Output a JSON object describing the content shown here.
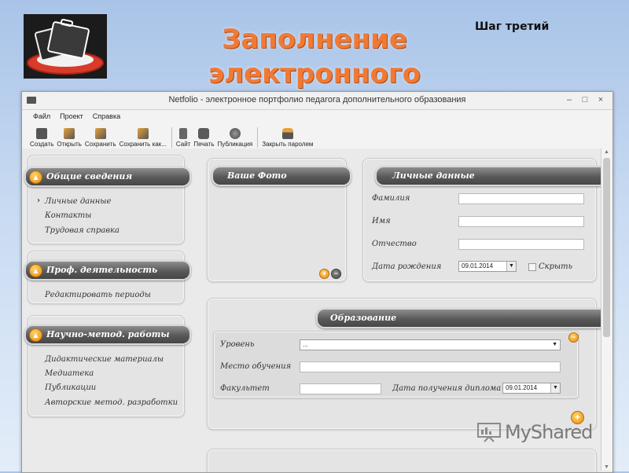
{
  "slide": {
    "title_line1": "Заполнение",
    "title_line2": "электронного портфолио.",
    "step": "Шаг третий",
    "watermark": "MyShared"
  },
  "window": {
    "title": "Netfolio - электронное портфолио педагога дополнительного образования",
    "controls": [
      "–",
      "□",
      "×"
    ]
  },
  "menu": [
    "Файл",
    "Проект",
    "Справка"
  ],
  "toolbar": [
    {
      "label": "Создать",
      "icon": "new-file-icon"
    },
    {
      "label": "Открыть",
      "icon": "open-folder-icon"
    },
    {
      "label": "Сохранить",
      "icon": "save-icon"
    },
    {
      "label": "Сохранить как...",
      "icon": "save-as-icon"
    },
    {
      "label": "Сайт",
      "icon": "site-icon"
    },
    {
      "label": "Печать",
      "icon": "printer-icon"
    },
    {
      "label": "Публикация",
      "icon": "globe-icon"
    },
    {
      "label": "Закрыть паролем",
      "icon": "lock-icon"
    }
  ],
  "sidebar": {
    "sections": [
      {
        "title": "Общие сведения",
        "items": [
          "Личные данные",
          "Контакты",
          "Трудовая справка"
        ]
      },
      {
        "title": "Проф. деятельность",
        "items": [
          "Редактировать периоды"
        ]
      },
      {
        "title": "Научно-метод. работы",
        "items": [
          "Дидактические материалы",
          "Медиатека",
          "Публикации",
          "Авторские метод. разработки"
        ]
      }
    ]
  },
  "photo_panel": {
    "title": "Ваше Фото"
  },
  "personal_panel": {
    "title": "Личные данные",
    "surname_label": "Фамилия",
    "name_label": "Имя",
    "patronymic_label": "Отчество",
    "birthdate_label": "Дата рождения",
    "birthdate_value": "09.01.2014",
    "hide_label": "Скрыть"
  },
  "education_panel": {
    "title": "Образование",
    "level_label": "Уровень",
    "level_value": "...",
    "place_label": "Место обучения",
    "faculty_label": "Факультет",
    "diploma_date_label": "Дата получения диплома",
    "diploma_date_value": "09.01.2014"
  },
  "colors": {
    "accent": "#f07a35",
    "pill_dark": "#4f4f4f",
    "orange_button": "#e98c12"
  }
}
